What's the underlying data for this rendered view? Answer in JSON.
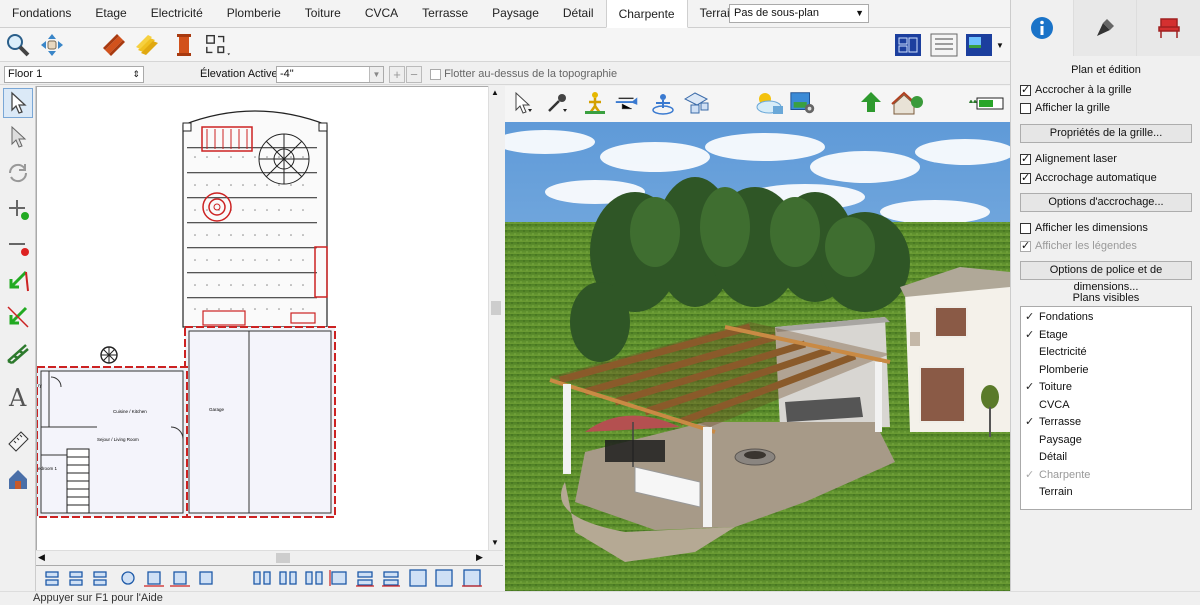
{
  "tabs": [
    "Fondations",
    "Etage",
    "Electricité",
    "Plomberie",
    "Toiture",
    "CVCA",
    "Terrasse",
    "Paysage",
    "Détail",
    "Charpente",
    "Terrain"
  ],
  "active_tab": "Charpente",
  "subplan": {
    "value": "Pas de sous-plan"
  },
  "floor": {
    "value": "Floor 1"
  },
  "elevation": {
    "label": "Élevation Active:",
    "value": "-4\""
  },
  "float_topo": {
    "label": "Flotter au-dessus de la topographie",
    "checked": false
  },
  "toolbar_icons": [
    "zoom-icon",
    "pan-icon",
    "steel-beam-icon",
    "lumber-icon",
    "wood-post-icon",
    "framing-tools-icon"
  ],
  "plan_labels": {
    "kitchen": "Cuisine / Kitchen",
    "living": "Sejour / Living Room",
    "garage": "Garage",
    "bedroom": "edroom 1",
    "partial": "ry"
  },
  "right_panel": {
    "section_title": "Plan et édition",
    "snap_grid": {
      "label": "Accrocher à la grille",
      "checked": true
    },
    "show_grid": {
      "label": "Afficher la grille",
      "checked": false
    },
    "grid_props_btn": "Propriétés de la grille...",
    "laser": {
      "label": "Alignement laser",
      "checked": true
    },
    "auto_snap": {
      "label": "Accrochage automatique",
      "checked": true
    },
    "snap_options_btn": "Options d'accrochage...",
    "show_dims": {
      "label": "Afficher les dimensions",
      "checked": false
    },
    "show_legends": {
      "label": "Afficher les légendes",
      "checked": true,
      "disabled": true
    },
    "font_dims_btn": "Options de police et de dimensions...",
    "visible_plans_title": "Plans visibles",
    "layers": [
      {
        "name": "Fondations",
        "checked": true,
        "dim": false
      },
      {
        "name": "Etage",
        "checked": true,
        "dim": false
      },
      {
        "name": "Electricité",
        "checked": false,
        "dim": false
      },
      {
        "name": "Plomberie",
        "checked": false,
        "dim": false
      },
      {
        "name": "Toiture",
        "checked": true,
        "dim": false
      },
      {
        "name": "CVCA",
        "checked": false,
        "dim": false
      },
      {
        "name": "Terrasse",
        "checked": true,
        "dim": false
      },
      {
        "name": "Paysage",
        "checked": false,
        "dim": false
      },
      {
        "name": "Détail",
        "checked": false,
        "dim": false
      },
      {
        "name": "Charpente",
        "checked": true,
        "dim": true
      },
      {
        "name": "Terrain",
        "checked": false,
        "dim": false
      }
    ]
  },
  "status_bar": "Appuyer sur F1 pour l'Aide",
  "colors": {
    "accent_blue": "#1a73c8",
    "wall_red": "#cc2222",
    "sky": "#6fa8dc",
    "grass": "#5d8c30"
  }
}
